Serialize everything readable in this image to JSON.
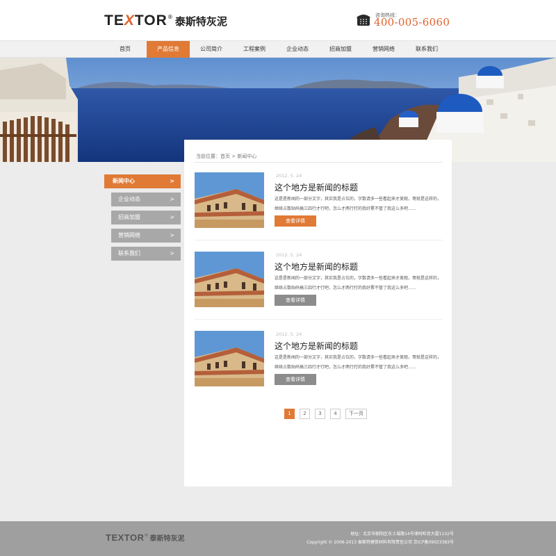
{
  "header": {
    "logo_prefix": "TE",
    "logo_x": "X",
    "logo_suffix": "TOR",
    "logo_reg": "®",
    "logo_cn": "泰斯特灰泥",
    "hotline_label": "咨询热线：",
    "hotline_number": "400-005-6060",
    "phone_icon": "telephone-icon"
  },
  "nav": {
    "items": [
      "首页",
      "产品信息",
      "公司简介",
      "工程案例",
      "企业动态",
      "招商加盟",
      "营销网络",
      "联系我们"
    ],
    "active_index": 1
  },
  "sidebar": {
    "items": [
      "新闻中心",
      "企业动态",
      "招商加盟",
      "营销网络",
      "联系我们"
    ],
    "chevron": ">",
    "active_index": 0
  },
  "breadcrumb": "当前位置：首页 > 新闻中心",
  "news": [
    {
      "date": "2012. 5. 24",
      "title": "这个地方是新闻的标题",
      "excerpt_line1": "这是是新闻的一部分文字，其实我是占位的，字数请多一些看起来才美观，哥就是这样的，",
      "excerpt_line2": "继续占数贴码搞三四行才行吧，怎么才两行打的我好累不管了我这么多吧……",
      "button": "查看详情",
      "highlight": true
    },
    {
      "date": "2012. 5. 24",
      "title": "这个地方是新闻的标题",
      "excerpt_line1": "这是是新闻的一部分文字，其实我是占位的，字数请多一些看起来才美观，哥就是这样的，",
      "excerpt_line2": "继续占数贴码搞三四行才行吧，怎么才两行打的我好累不管了我这么多吧……",
      "button": "查看详情",
      "highlight": false
    },
    {
      "date": "2012. 5. 24",
      "title": "这个地方是新闻的标题",
      "excerpt_line1": "这是是新闻的一部分文字，其实我是占位的，字数请多一些看起来才美观，哥就是这样的，",
      "excerpt_line2": "继续占数贴码搞三四行才行吧，怎么才两行打的我好累不管了我这么多吧……",
      "button": "查看详情",
      "highlight": false
    }
  ],
  "pagination": {
    "pages": [
      "1",
      "2",
      "3",
      "4"
    ],
    "current": "1",
    "next": "下一页"
  },
  "footer": {
    "logo_prefix": "TE",
    "logo_x": "X",
    "logo_suffix": "TOR",
    "logo_reg": "®",
    "logo_cn": "泰斯特灰泥",
    "address": "地址：北京市朝阳区东土城路14号律时旺贸大厦1102号",
    "copyright": "Copyright © 2006-2013  泰斯特建筑材料有限责任公司   京ICP备09023383号"
  },
  "colors": {
    "accent": "#e07a35",
    "nav_bg": "#f1f1f1",
    "sidebar_inactive": "#a8a8a8",
    "footer_bg": "#9f9f9f",
    "page_bg": "#ececec"
  }
}
